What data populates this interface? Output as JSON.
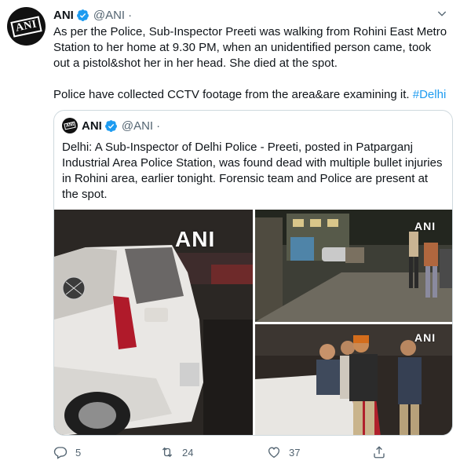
{
  "tweet": {
    "author": {
      "name": "ANI",
      "handle": "@ANI",
      "avatar_text": "ANI"
    },
    "separator": "·",
    "paragraphs": [
      "As per the Police, Sub-Inspector Preeti was walking from Rohini East Metro Station to her home at 9.30 PM, when an unidentified person came, took out a pistol&shot her in her head. She died at the spot.",
      "Police have collected CCTV footage from the area&are examining it."
    ],
    "hashtag": "#Delhi",
    "quoted": {
      "author": {
        "name": "ANI",
        "handle": "@ANI",
        "avatar_text": "ANI"
      },
      "separator": "·",
      "text": "Delhi: A Sub-Inspector of Delhi Police - Preeti, posted in Patparganj Industrial Area Police Station, was found dead with multiple bullet injuries in Rohini area, earlier tonight. Forensic team and Police are present at the spot.",
      "images": [
        {
          "watermark": "ANI"
        },
        {
          "watermark": "ANI"
        },
        {
          "watermark": "ANI"
        }
      ]
    },
    "actions": {
      "reply_count": "5",
      "retweet_count": "24",
      "like_count": "37"
    }
  },
  "colors": {
    "accent": "#1d9bf0",
    "text": "#0f1419",
    "muted": "#536471",
    "border": "#cfd9de"
  },
  "icons": [
    "verified-badge-icon",
    "chevron-down-icon",
    "reply-icon",
    "retweet-icon",
    "like-icon",
    "share-icon"
  ]
}
